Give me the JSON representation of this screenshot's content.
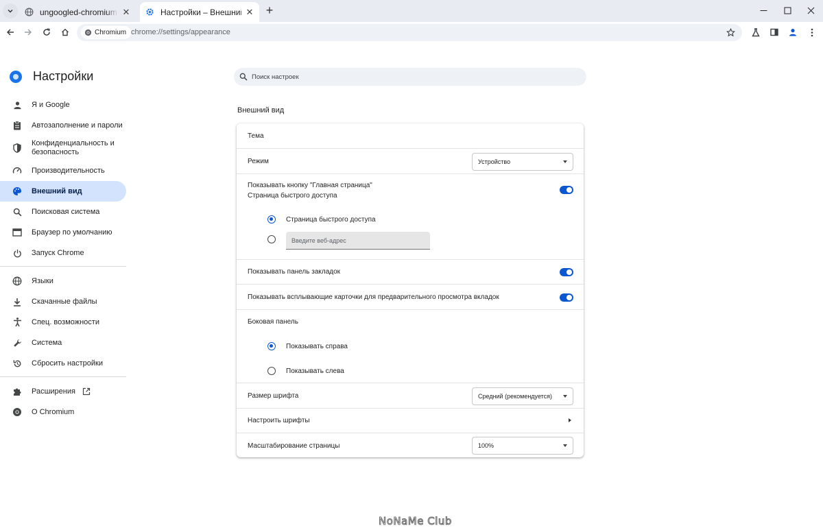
{
  "browser": {
    "tabs": [
      {
        "title": "ungoogled-chromium first run",
        "active": false
      },
      {
        "title": "Настройки – Внешний вид",
        "active": true
      }
    ],
    "omnibox": {
      "chip": "Chromium",
      "url": "chrome://settings/appearance"
    }
  },
  "sidebar": {
    "title": "Настройки",
    "items": [
      {
        "label": "Я и Google",
        "icon": "person-icon"
      },
      {
        "label": "Автозаполнение и пароли",
        "icon": "clipboard-icon"
      },
      {
        "label": "Конфиденциальность и безопасность",
        "icon": "shield-icon"
      },
      {
        "label": "Производительность",
        "icon": "gauge-icon"
      },
      {
        "label": "Внешний вид",
        "icon": "palette-icon",
        "selected": true
      },
      {
        "label": "Поисковая система",
        "icon": "search-icon"
      },
      {
        "label": "Браузер по умолчанию",
        "icon": "browser-icon"
      },
      {
        "label": "Запуск Chrome",
        "icon": "power-icon"
      },
      {
        "label": "Языки",
        "icon": "globe-icon"
      },
      {
        "label": "Скачанные файлы",
        "icon": "download-icon"
      },
      {
        "label": "Спец. возможности",
        "icon": "accessibility-icon"
      },
      {
        "label": "Система",
        "icon": "wrench-icon"
      },
      {
        "label": "Сбросить настройки",
        "icon": "reset-icon"
      },
      {
        "label": "Расширения",
        "icon": "puzzle-icon"
      },
      {
        "label": "О Chromium",
        "icon": "chromium-icon"
      }
    ]
  },
  "main": {
    "search_placeholder": "Поиск настроек",
    "section_title": "Внешний вид",
    "theme": "Тема",
    "mode": {
      "label": "Режим",
      "value": "Устройство"
    },
    "home_button": {
      "label": "Показывать кнопку \"Главная страница\"",
      "sublabel": "Страница быстрого доступа",
      "enabled": true
    },
    "home_options": {
      "quick_access": "Страница быстрого доступа",
      "url_placeholder": "Введите веб-адрес"
    },
    "bookmarks_bar": {
      "label": "Показывать панель закладок",
      "enabled": true
    },
    "tab_previews": {
      "label": "Показывать всплывающие карточки для предварительного просмотра вкладок",
      "enabled": true
    },
    "side_panel": {
      "label": "Боковая панель",
      "right": "Показывать справа",
      "left": "Показывать слева"
    },
    "font_size": {
      "label": "Размер шрифта",
      "value": "Средний (рекомендуется)"
    },
    "customize_fonts": "Настроить шрифты",
    "page_zoom": {
      "label": "Масштабирование страницы",
      "value": "100%"
    }
  },
  "watermark": "NoNaMe Club",
  "colors": {
    "accent": "#0b57d0",
    "selected_bg": "#d3e3fd",
    "omnibox_bg": "#eef1f6"
  }
}
